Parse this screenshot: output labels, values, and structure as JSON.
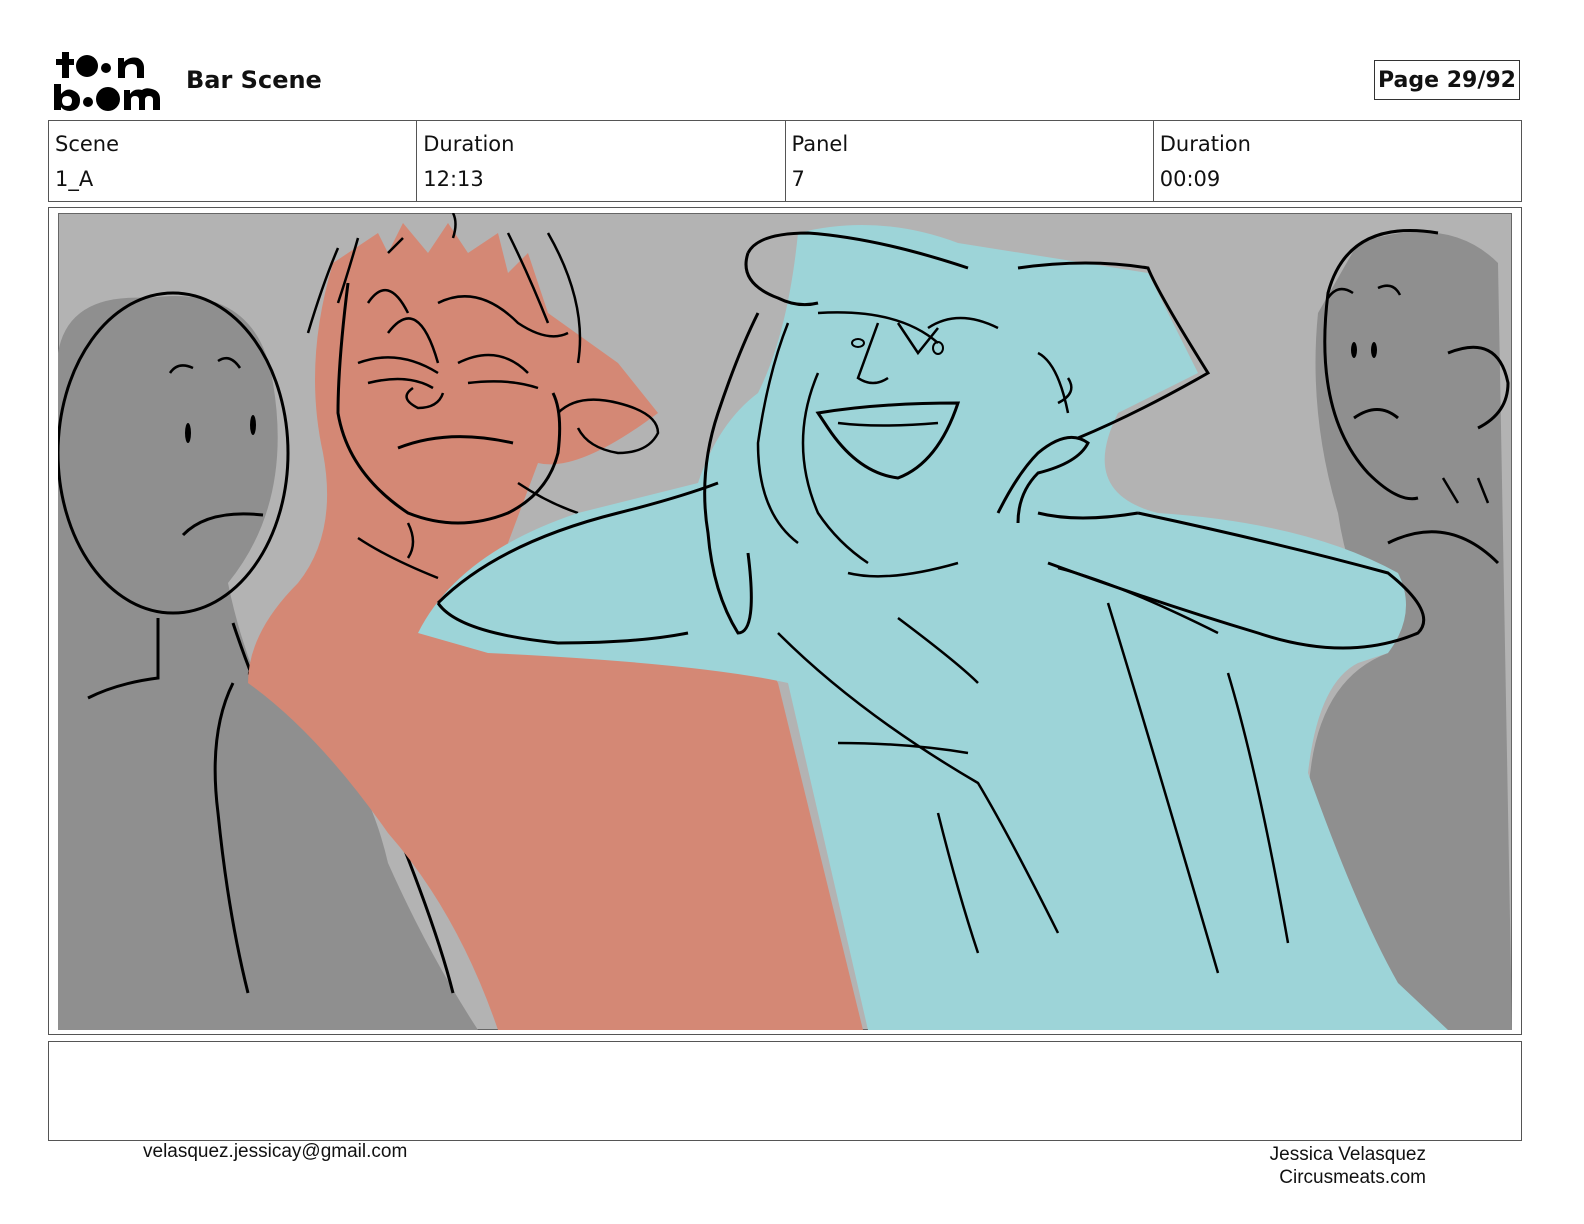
{
  "header": {
    "logo_text": "toon boom",
    "title": "Bar Scene",
    "page_label": "Page 29/92"
  },
  "info": {
    "scene_label": "Scene",
    "scene_value": "1_A",
    "duration_label": "Duration",
    "duration_value": "12:13",
    "panel_label": "Panel",
    "panel_value": "7",
    "panel_duration_label": "Duration",
    "panel_duration_value": "00:09"
  },
  "panel": {
    "colors": {
      "background": "#b3b3b3",
      "crowd": "#8f8f8f",
      "left_character": "#d48875",
      "right_character": "#9dd4d8"
    }
  },
  "notes": {
    "text": ""
  },
  "footer": {
    "email": "velasquez.jessicay@gmail.com",
    "name": "Jessica Velasquez",
    "site": "Circusmeats.com"
  }
}
